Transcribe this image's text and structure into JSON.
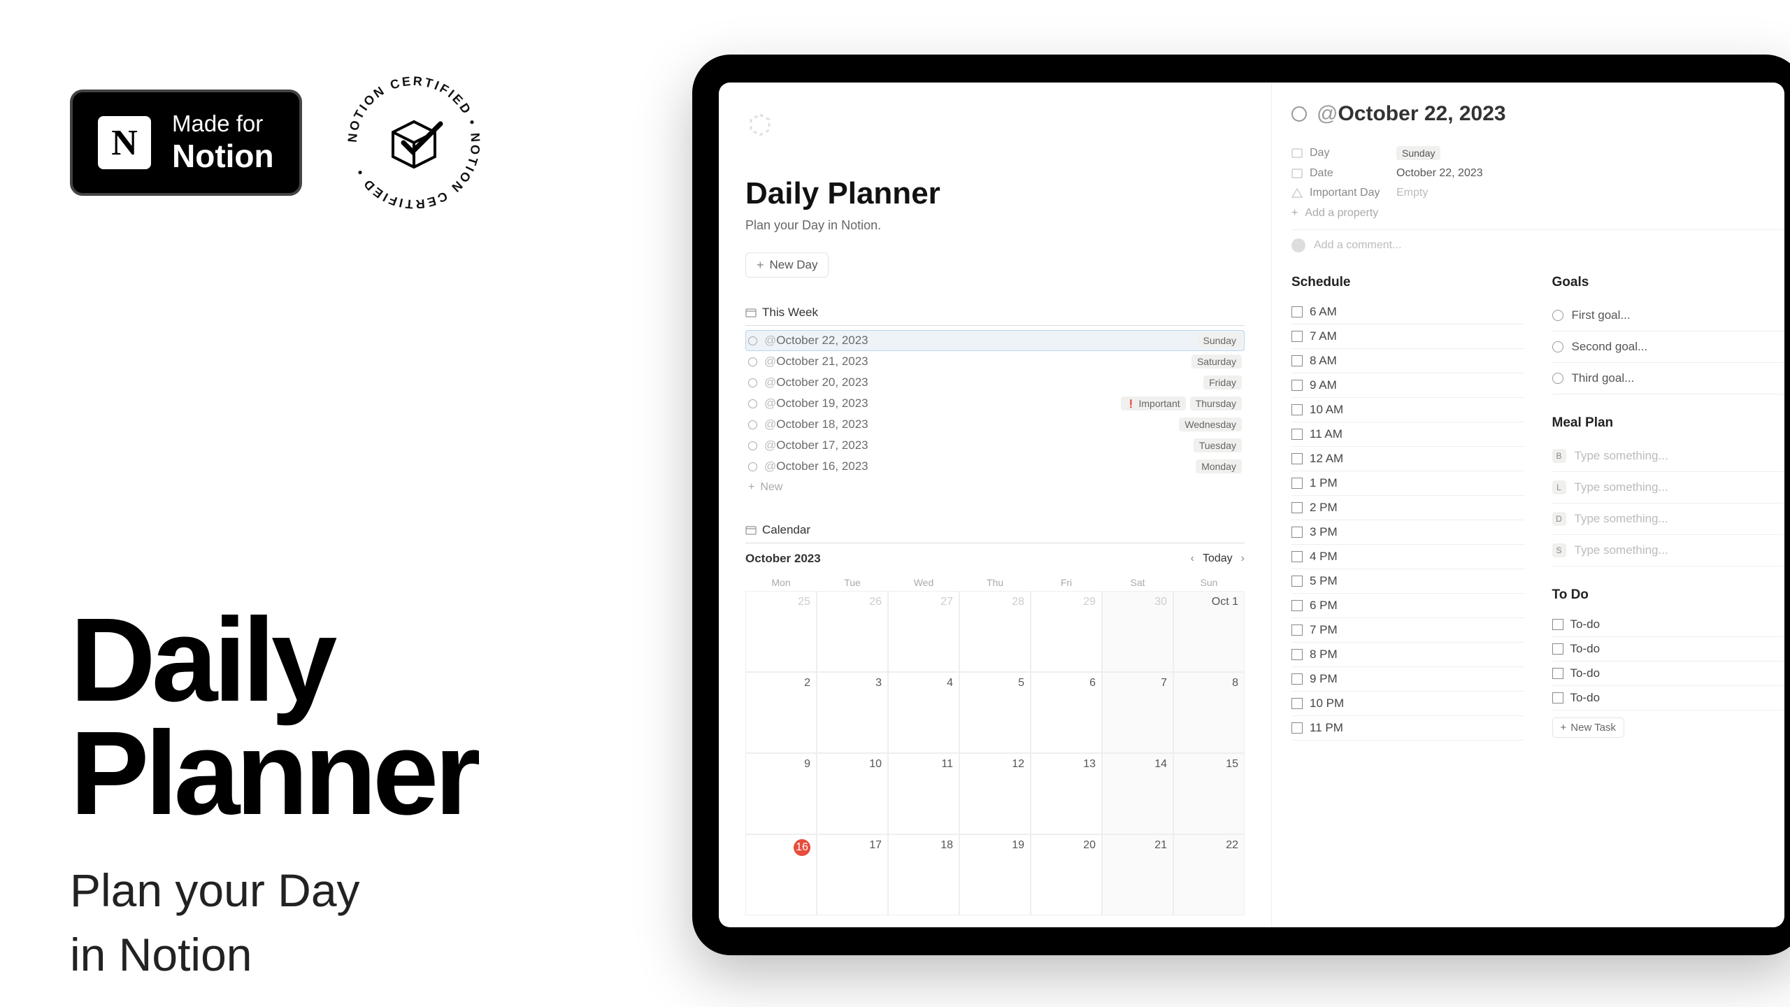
{
  "badges": {
    "made_for_line1": "Made for",
    "made_for_line2": "Notion",
    "certified_text": "NOTION CERTIFIED • NOTION CERTIFIED •"
  },
  "hero": {
    "title_line1": "Daily",
    "title_line2": "Planner",
    "sub_line1": "Plan your Day",
    "sub_line2": "in Notion"
  },
  "page": {
    "title": "Daily Planner",
    "subtitle": "Plan your Day in Notion.",
    "new_day_label": "New Day",
    "this_week_label": "This Week",
    "calendar_label": "Calendar",
    "add_new_label": "New"
  },
  "week": [
    {
      "date": "October 22, 2023",
      "day": "Sunday",
      "important": false,
      "selected": true
    },
    {
      "date": "October 21, 2023",
      "day": "Saturday",
      "important": false,
      "selected": false
    },
    {
      "date": "October 20, 2023",
      "day": "Friday",
      "important": false,
      "selected": false
    },
    {
      "date": "October 19, 2023",
      "day": "Thursday",
      "important": true,
      "selected": false
    },
    {
      "date": "October 18, 2023",
      "day": "Wednesday",
      "important": false,
      "selected": false
    },
    {
      "date": "October 17, 2023",
      "day": "Tuesday",
      "important": false,
      "selected": false
    },
    {
      "date": "October 16, 2023",
      "day": "Monday",
      "important": false,
      "selected": false
    }
  ],
  "important_label": "Important",
  "calendar": {
    "month": "October 2023",
    "today_label": "Today",
    "day_names": [
      "Mon",
      "Tue",
      "Wed",
      "Thu",
      "Fri",
      "Sat",
      "Sun"
    ],
    "weeks": [
      [
        {
          "n": "25",
          "dim": true
        },
        {
          "n": "26",
          "dim": true
        },
        {
          "n": "27",
          "dim": true
        },
        {
          "n": "28",
          "dim": true
        },
        {
          "n": "29",
          "dim": true
        },
        {
          "n": "30",
          "dim": true,
          "shaded": true
        },
        {
          "n": "Oct 1",
          "shaded": true
        }
      ],
      [
        {
          "n": "2"
        },
        {
          "n": "3"
        },
        {
          "n": "4"
        },
        {
          "n": "5"
        },
        {
          "n": "6"
        },
        {
          "n": "7",
          "shaded": true
        },
        {
          "n": "8",
          "shaded": true
        }
      ],
      [
        {
          "n": "9"
        },
        {
          "n": "10"
        },
        {
          "n": "11"
        },
        {
          "n": "12"
        },
        {
          "n": "13"
        },
        {
          "n": "14",
          "shaded": true
        },
        {
          "n": "15",
          "shaded": true
        }
      ],
      [
        {
          "n": "16",
          "today": true
        },
        {
          "n": "17"
        },
        {
          "n": "18"
        },
        {
          "n": "19"
        },
        {
          "n": "20"
        },
        {
          "n": "21",
          "shaded": true
        },
        {
          "n": "22",
          "shaded": true
        }
      ]
    ]
  },
  "detail": {
    "title": "October 22, 2023",
    "props": {
      "day_label": "Day",
      "day_value": "Sunday",
      "date_label": "Date",
      "date_value": "October 22, 2023",
      "important_label": "Important Day",
      "important_value": "Empty",
      "add_property": "Add a property"
    },
    "comment_placeholder": "Add a comment...",
    "schedule_title": "Schedule",
    "schedule": [
      "6 AM",
      "7 AM",
      "8 AM",
      "9 AM",
      "10 AM",
      "11 AM",
      "12 AM",
      "1 PM",
      "2 PM",
      "3 PM",
      "4 PM",
      "5 PM",
      "6 PM",
      "7 PM",
      "8 PM",
      "9 PM",
      "10 PM",
      "11 PM"
    ],
    "goals_title": "Goals",
    "goals": [
      "First goal...",
      "Second goal...",
      "Third goal..."
    ],
    "meal_title": "Meal Plan",
    "meals": [
      {
        "badge": "B",
        "text": "Type something..."
      },
      {
        "badge": "L",
        "text": "Type something..."
      },
      {
        "badge": "D",
        "text": "Type something..."
      },
      {
        "badge": "S",
        "text": "Type something..."
      }
    ],
    "todo_title": "To Do",
    "todos": [
      "To-do",
      "To-do",
      "To-do",
      "To-do"
    ],
    "new_task_label": "New Task"
  }
}
